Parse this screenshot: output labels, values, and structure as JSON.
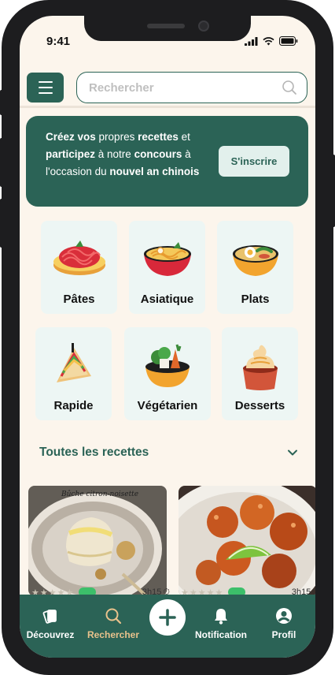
{
  "status_bar": {
    "time": "9:41"
  },
  "search": {
    "placeholder": "Rechercher"
  },
  "banner": {
    "w1": "Créez vos",
    "w2": " propres ",
    "w3": "recettes",
    "w4": " et ",
    "w5": "participez",
    "w6": " à notre ",
    "w7": "concours",
    "w8": " à l'occasion du ",
    "w9": "nouvel an chinois",
    "button": "S'inscrire"
  },
  "categories": [
    {
      "label": "Pâtes",
      "icon": "pasta-icon"
    },
    {
      "label": "Asiatique",
      "icon": "ramen-icon"
    },
    {
      "label": "Plats",
      "icon": "bowl-icon"
    },
    {
      "label": "Rapide",
      "icon": "sandwich-icon"
    },
    {
      "label": "Végétarien",
      "icon": "vegetables-icon"
    },
    {
      "label": "Desserts",
      "icon": "ice-cream-icon"
    }
  ],
  "recipes_section": {
    "title": "Toutes les recettes"
  },
  "recipes": [
    {
      "photo_caption": "Bûche citron-noisette",
      "duration": "3h15"
    },
    {
      "duration": "3h15"
    }
  ],
  "tabs": [
    {
      "label": "Découvrez",
      "icon": "cards-icon"
    },
    {
      "label": "Rechercher",
      "icon": "search-icon"
    },
    {
      "label": "Notification",
      "icon": "bell-icon"
    },
    {
      "label": "Profil",
      "icon": "profile-icon"
    }
  ],
  "colors": {
    "primary": "#2b6356",
    "background": "#fcf5ec",
    "active_tab": "#e9c28c",
    "category_card": "#edf6f4"
  }
}
